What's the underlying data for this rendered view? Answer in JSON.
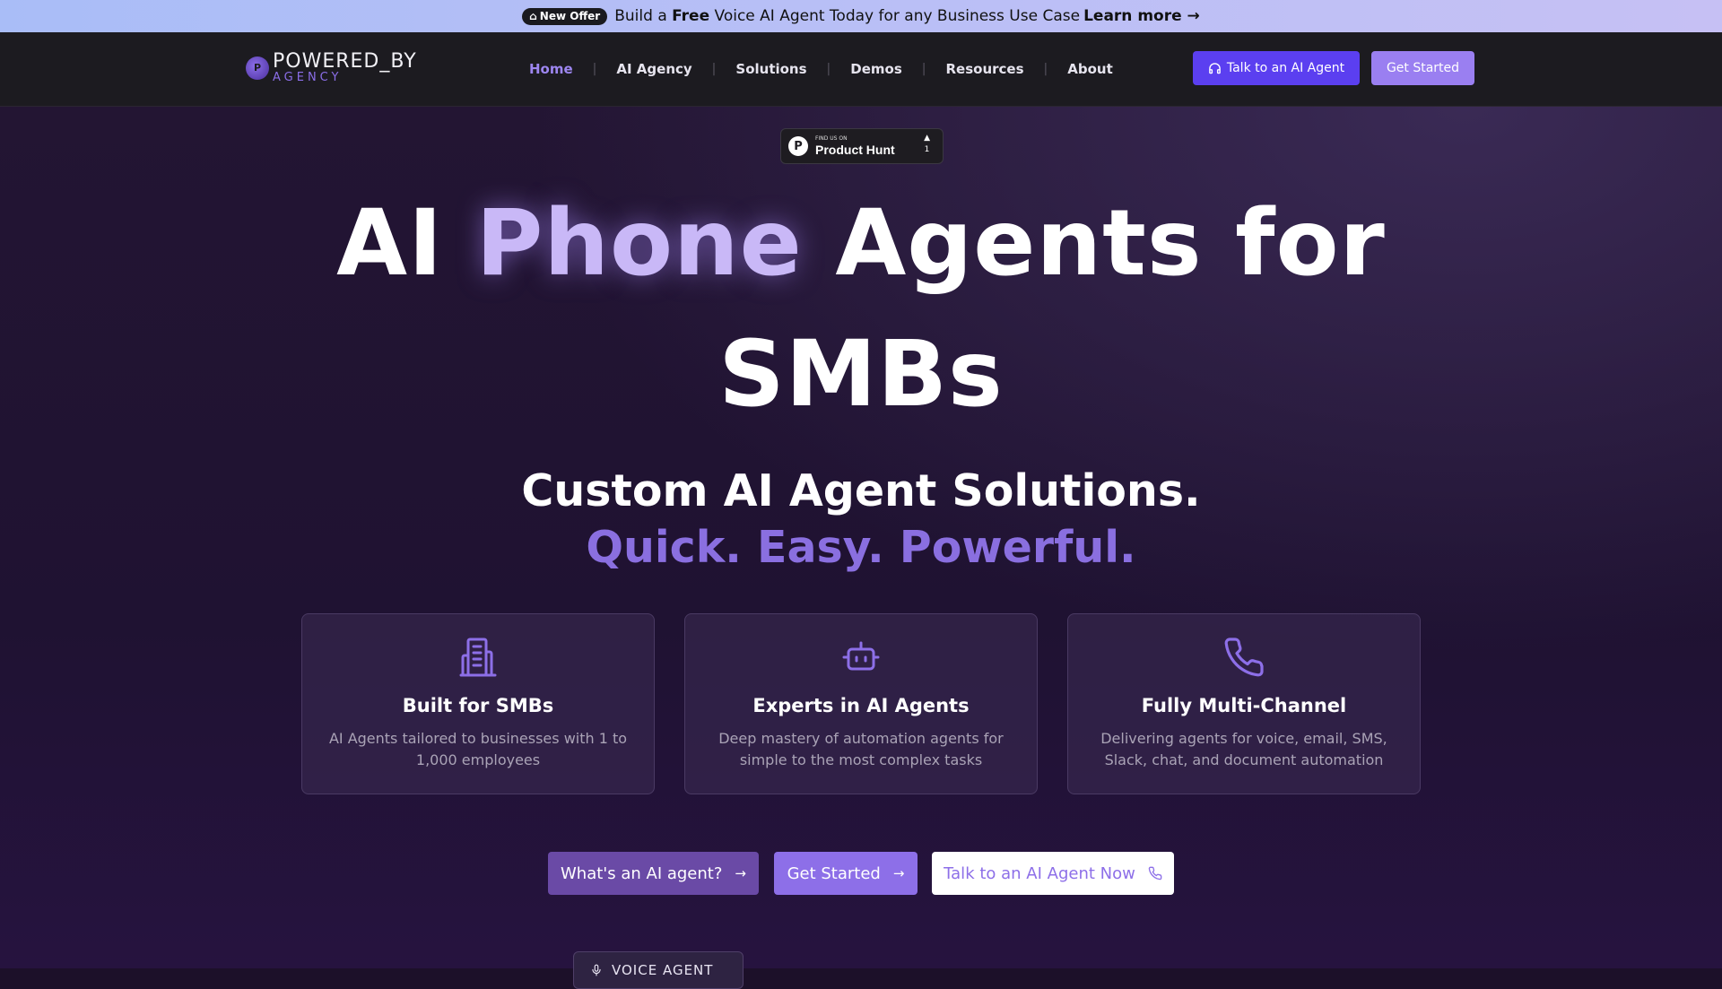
{
  "announcement": {
    "badge": "New Offer",
    "text_pre": "Build a",
    "text_bold": "Free",
    "text_post": "Voice AI Agent Today for any Business Use Case",
    "link": "Learn more →"
  },
  "logo": {
    "line1": "POWERED_BY",
    "line2": "AGENCY",
    "mark": "P"
  },
  "nav": {
    "items": [
      {
        "label": "Home",
        "active": true
      },
      {
        "label": "AI Agency"
      },
      {
        "label": "Solutions"
      },
      {
        "label": "Demos"
      },
      {
        "label": "Resources"
      },
      {
        "label": "About"
      }
    ],
    "talk_button": "Talk to an AI Agent",
    "start_button": "Get Started"
  },
  "product_hunt": {
    "small": "FIND US ON",
    "name": "Product Hunt",
    "votes": "1",
    "mark": "P"
  },
  "hero": {
    "headline_1": "AI",
    "headline_accent": "Phone",
    "headline_2": "Agents for",
    "headline_3": "SMBs",
    "subtitle_1": "Custom AI Agent Solutions.",
    "subtitle_2": "Quick. Easy. Powerful."
  },
  "features": [
    {
      "icon": "building-icon",
      "title": "Built for SMBs",
      "desc": "AI Agents tailored to businesses with 1 to 1,000 employees"
    },
    {
      "icon": "robot-icon",
      "title": "Experts in AI Agents",
      "desc": "Deep mastery of automation agents for simple to the most complex tasks"
    },
    {
      "icon": "phone-icon",
      "title": "Fully Multi-Channel",
      "desc": "Delivering agents for voice, email, SMS, Slack, chat, and document automation"
    }
  ],
  "cta": {
    "what": "What's an AI agent?",
    "start": "Get Started",
    "talk": "Talk to an AI Agent Now"
  },
  "voice_agent_badge": "VOICE AGENT",
  "colors": {
    "accent": "#8d6fe8",
    "primary_button": "#5b3ff0",
    "background": "#1f1232"
  }
}
